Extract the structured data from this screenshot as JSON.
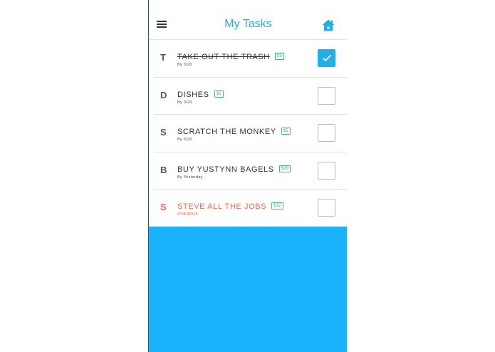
{
  "header": {
    "title": "My Tasks",
    "menu_icon": "hamburger-menu-icon",
    "home_icon": "home-icon"
  },
  "colors": {
    "accent": "#22aee6",
    "panel": "#1ab2fa",
    "badge": "#3dbb7a",
    "overdue": "#f0684c"
  },
  "tasks": [
    {
      "letter": "T",
      "name": "TAKE OUT THE TRASH",
      "reward": "$5",
      "due": "By 3/20",
      "checked": true,
      "status": "done"
    },
    {
      "letter": "D",
      "name": "DISHES",
      "reward": "$5",
      "due": "By 3/20",
      "checked": false,
      "status": "open"
    },
    {
      "letter": "S",
      "name": "SCRATCH THE MONKEY",
      "reward": "$5",
      "due": "By 3/20",
      "checked": false,
      "status": "open"
    },
    {
      "letter": "B",
      "name": "BUY YUSTYNN BAGELS",
      "reward": "$99",
      "due": "By Yesterday",
      "checked": false,
      "status": "open"
    },
    {
      "letter": "S",
      "name": "STEVE ALL THE JOBS",
      "reward": "$12",
      "due": "OVERDUE",
      "checked": false,
      "status": "overdue"
    }
  ]
}
